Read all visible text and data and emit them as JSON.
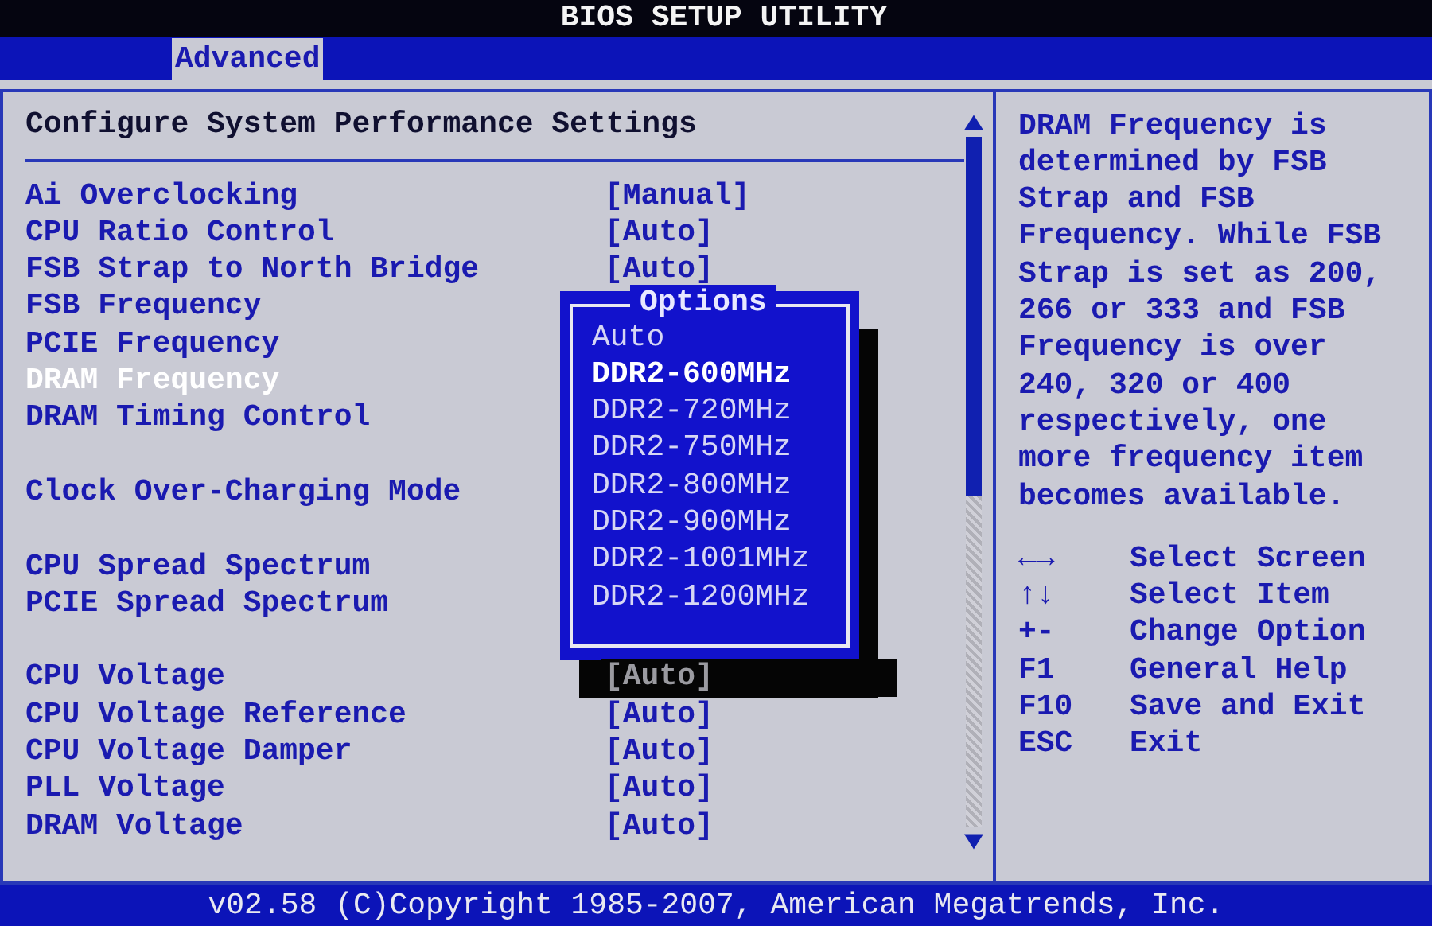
{
  "window": {
    "title": "BIOS SETUP UTILITY"
  },
  "tabs": [
    {
      "label": "Advanced",
      "selected": true
    }
  ],
  "panel": {
    "heading": "Configure System Performance Settings",
    "groups": [
      {
        "items": [
          {
            "label": "Ai Overclocking",
            "value": "[Manual]",
            "selected": false
          },
          {
            "label": "CPU Ratio Control",
            "value": "[Auto]",
            "selected": false
          },
          {
            "label": "FSB Strap to North Bridge",
            "value": "[Auto]",
            "selected": false
          },
          {
            "label": "FSB Frequency",
            "selected": false
          },
          {
            "label": "PCIE Frequency",
            "selected": false
          },
          {
            "label": "DRAM Frequency",
            "selected": true
          },
          {
            "label": "DRAM Timing Control",
            "selected": false
          }
        ]
      },
      {
        "items": [
          {
            "label": "Clock Over-Charging Mode",
            "selected": false
          }
        ]
      },
      {
        "items": [
          {
            "label": "CPU Spread Spectrum",
            "selected": false
          },
          {
            "label": "PCIE Spread Spectrum",
            "selected": false
          }
        ]
      },
      {
        "items": [
          {
            "label": "CPU Voltage",
            "value": "[Auto]",
            "dimmed": true,
            "selected": false
          },
          {
            "label": "CPU Voltage Reference",
            "value": "[Auto]",
            "selected": false
          },
          {
            "label": "CPU Voltage Damper",
            "value": "[Auto]",
            "selected": false
          },
          {
            "label": "PLL Voltage",
            "value": "[Auto]",
            "selected": false
          },
          {
            "label": "DRAM Voltage",
            "value": "[Auto]",
            "selected": false
          }
        ]
      }
    ]
  },
  "options_popup": {
    "title": "Options",
    "options": [
      {
        "label": "Auto",
        "selected": false
      },
      {
        "label": "DDR2-600MHz",
        "selected": true
      },
      {
        "label": "DDR2-720MHz",
        "selected": false
      },
      {
        "label": "DDR2-750MHz",
        "selected": false
      },
      {
        "label": "DDR2-800MHz",
        "selected": false
      },
      {
        "label": "DDR2-900MHz",
        "selected": false
      },
      {
        "label": "DDR2-1001MHz",
        "selected": false
      },
      {
        "label": "DDR2-1200MHz",
        "selected": false
      }
    ]
  },
  "help": {
    "text": "DRAM Frequency is determined by FSB Strap and FSB Frequency. While FSB Strap is set as 200, 266 or 333 and FSB Frequency is over 240, 320 or 400 respectively, one more frequency item becomes available.",
    "keys": [
      {
        "key": "←→",
        "action": "Select Screen"
      },
      {
        "key": "↑↓",
        "action": "Select Item"
      },
      {
        "key": "+-",
        "action": "Change Option"
      },
      {
        "key": "F1",
        "action": "General Help"
      },
      {
        "key": "F10",
        "action": "Save and Exit"
      },
      {
        "key": "ESC",
        "action": "Exit"
      }
    ]
  },
  "status_bar": {
    "text": "v02.58 (C)Copyright 1985-2007, American Megatrends, Inc."
  }
}
